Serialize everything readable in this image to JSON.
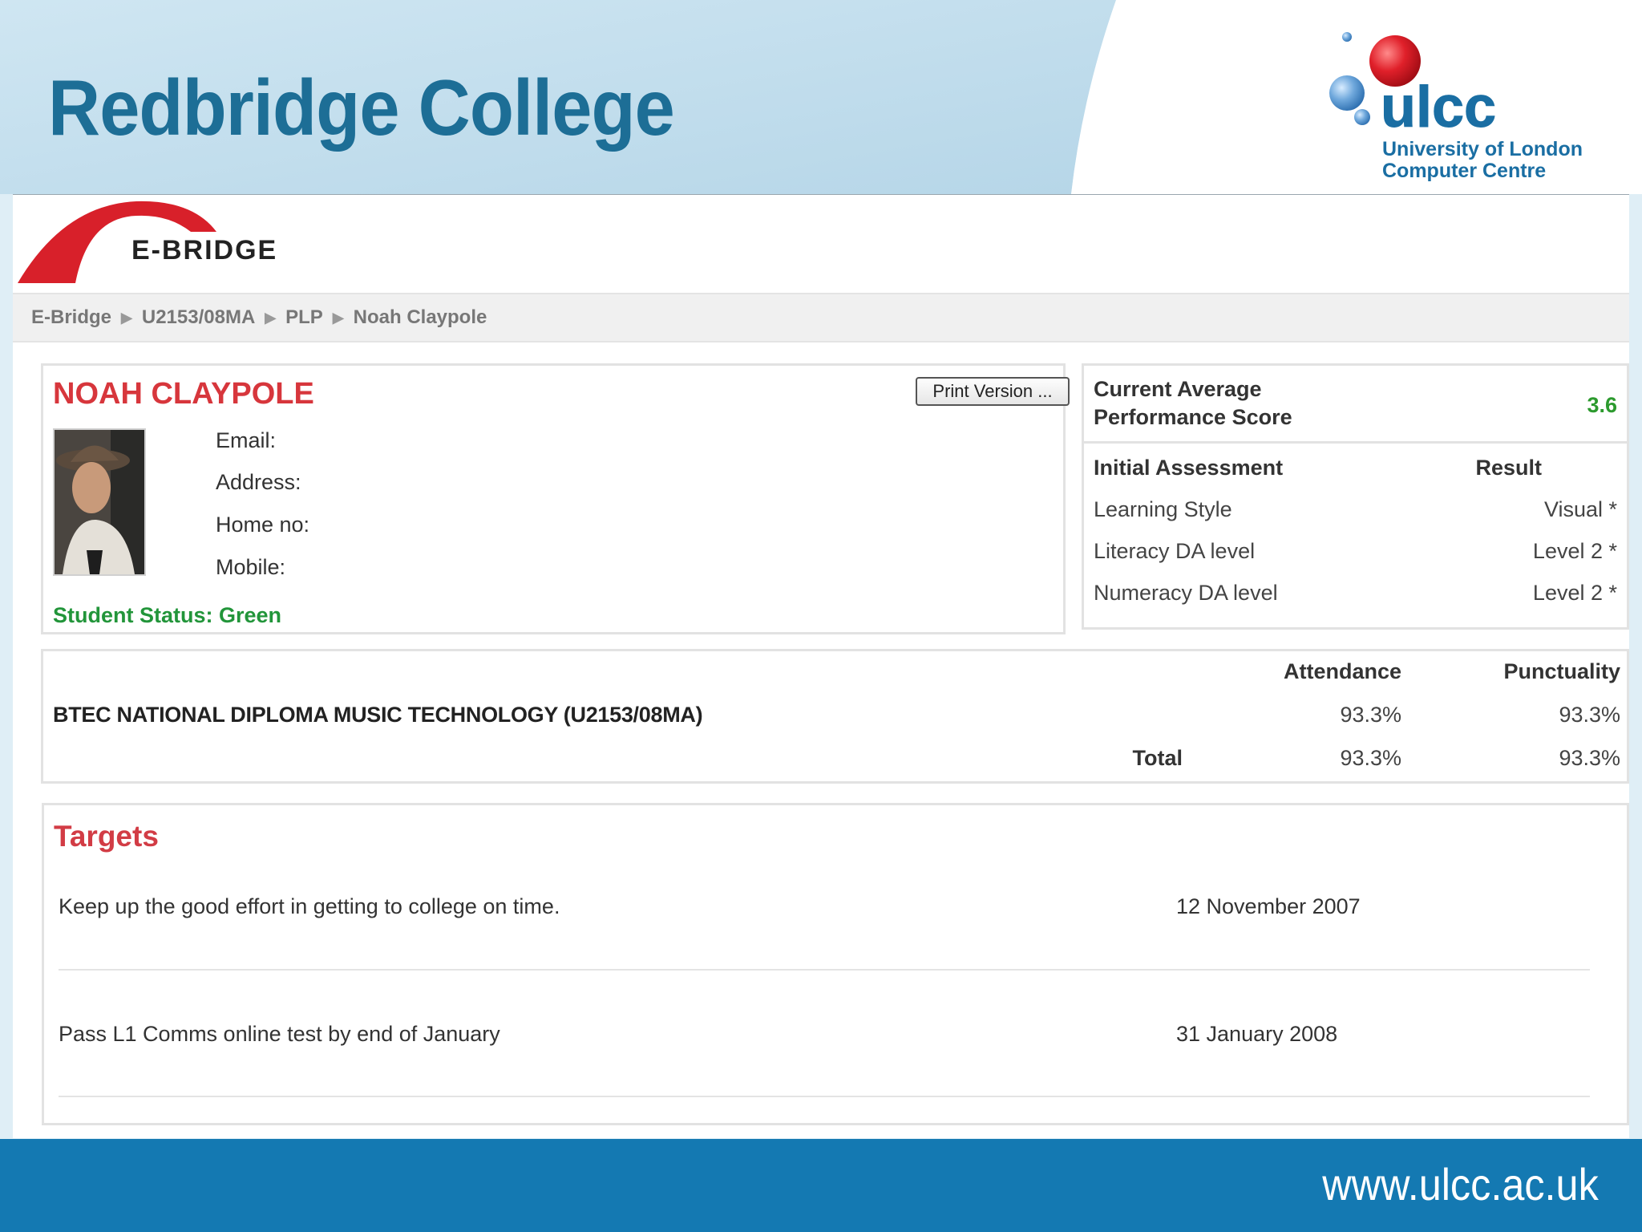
{
  "slide": {
    "title": "Redbridge College",
    "footer_url": "www.ulcc.ac.uk",
    "logo": {
      "wordmark": "ulcc",
      "line1": "University of London",
      "line2": "Computer Centre"
    }
  },
  "app": {
    "brand": "E-BRIDGE",
    "breadcrumb": [
      "E-Bridge",
      "U2153/08MA",
      "PLP",
      "Noah Claypole"
    ]
  },
  "student": {
    "name": "NOAH CLAYPOLE",
    "print_button": "Print Version ...",
    "contact_labels": [
      "Email:",
      "Address:",
      "Home no:",
      "Mobile:"
    ],
    "status": "Student Status: Green"
  },
  "score": {
    "label": "Current Average Performance Score",
    "value": "3.6",
    "header": {
      "assessment": "Initial Assessment",
      "result": "Result"
    },
    "rows": [
      {
        "name": "Learning Style",
        "result": "Visual *"
      },
      {
        "name": "Literacy DA level",
        "result": "Level 2 *"
      },
      {
        "name": "Numeracy DA level",
        "result": "Level 2 *"
      }
    ]
  },
  "course": {
    "headers": {
      "attendance": "Attendance",
      "punctuality": "Punctuality"
    },
    "name": "BTEC NATIONAL DIPLOMA MUSIC TECHNOLOGY (U2153/08MA)",
    "attendance": "93.3%",
    "punctuality": "93.3%",
    "total_label": "Total",
    "total_attendance": "93.3%",
    "total_punctuality": "93.3%"
  },
  "targets": {
    "title": "Targets",
    "items": [
      {
        "text": "Keep up the good effort in getting to college on time.",
        "date": "12 November 2007"
      },
      {
        "text": "Pass L1 Comms online test by end of January",
        "date": "31 January 2008"
      }
    ]
  },
  "colors": {
    "title_blue": "#1d6e96",
    "footer_blue": "#1479b2",
    "name_red": "#d7363c",
    "status_green": "#22953a",
    "score_green": "#2c9a2e"
  }
}
